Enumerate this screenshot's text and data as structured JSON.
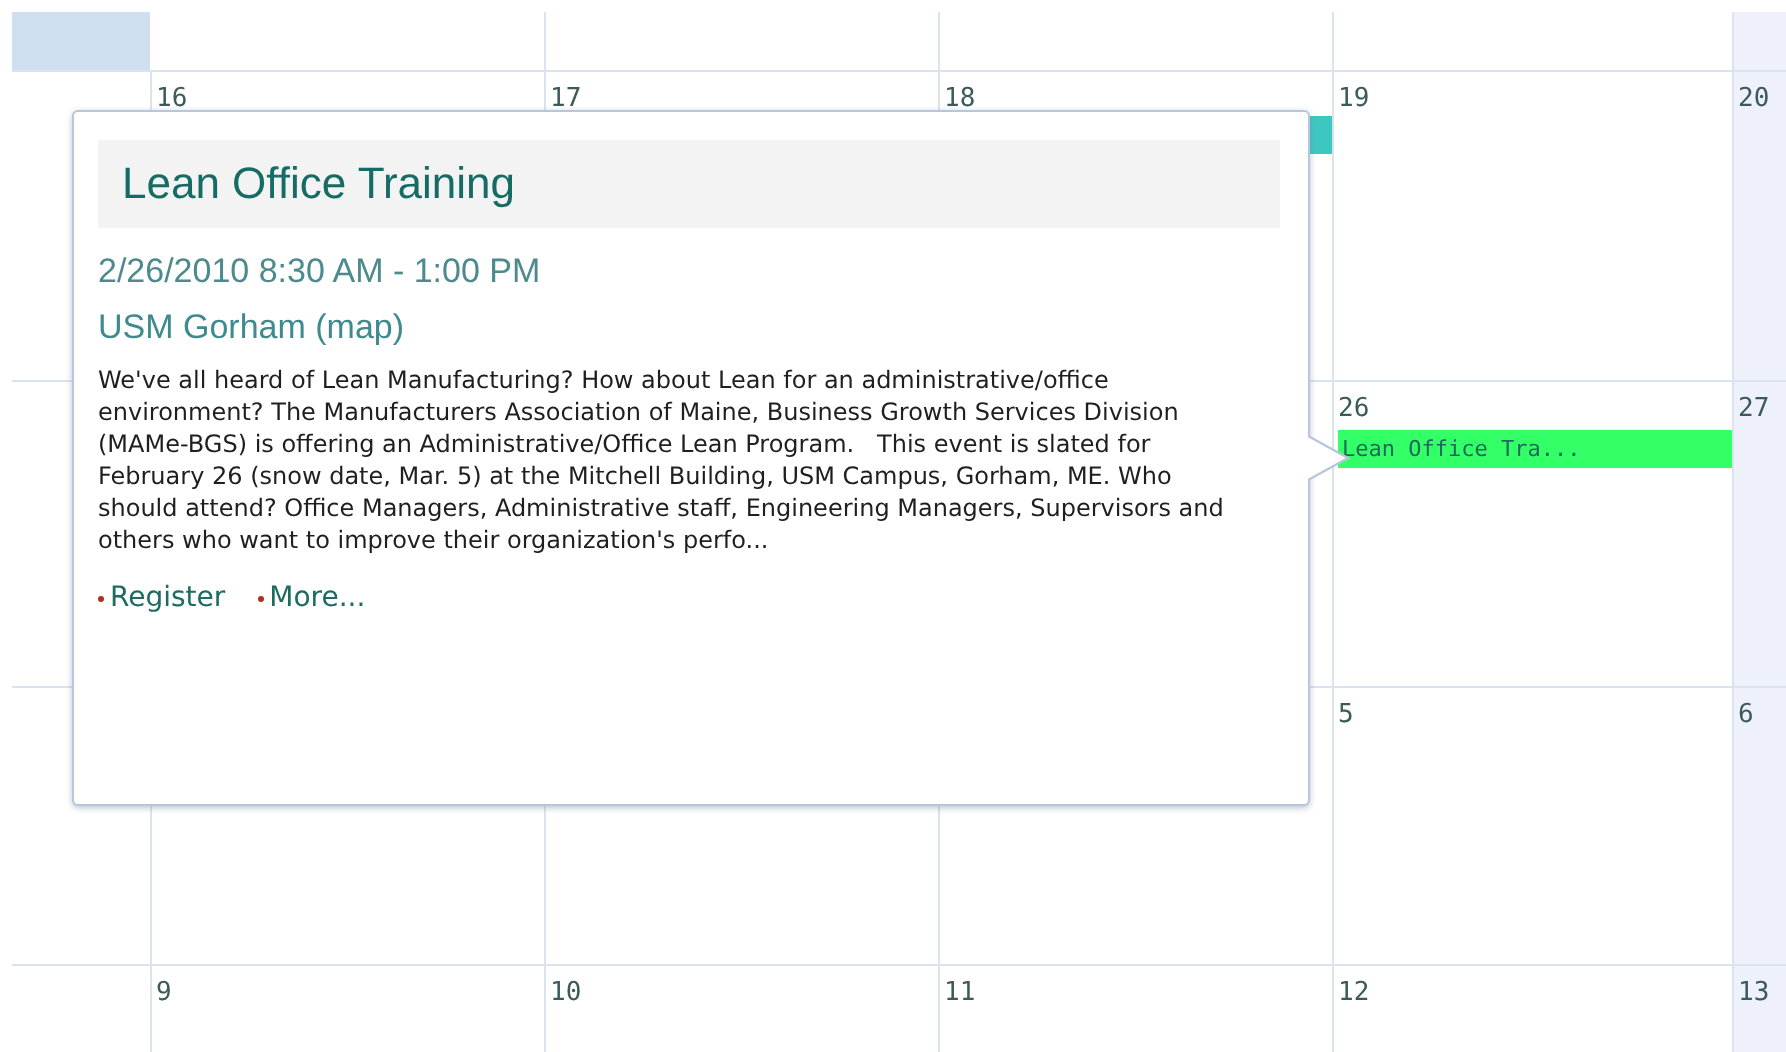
{
  "weeks": [
    {
      "days": [
        {
          "number": "16"
        },
        {
          "number": "17"
        },
        {
          "number": "18",
          "events": [
            {
              "color": "#3cc8c0"
            }
          ]
        },
        {
          "number": "19"
        },
        {
          "number": "20",
          "weekend": true
        }
      ]
    },
    {
      "days": [
        {
          "number": "26",
          "events": [
            {
              "title": "Lean Office Tra...",
              "color": "#33ff66"
            }
          ]
        },
        {
          "number": "27",
          "weekend": true
        }
      ]
    },
    {
      "days": [
        {
          "number": "5"
        },
        {
          "number": "6",
          "weekend": true
        }
      ]
    },
    {
      "days": [
        {
          "number": "9"
        },
        {
          "number": "10"
        },
        {
          "number": "11"
        },
        {
          "number": "12"
        },
        {
          "number": "13",
          "weekend": true
        }
      ]
    }
  ],
  "popup": {
    "title": "Lean Office Training",
    "datetime": "2/26/2010 8:30 AM - 1:00 PM",
    "location": "USM Gorham (map)",
    "description": "We've all heard of Lean Manufacturing? How about Lean for an administrative/office environment? The Manufacturers Association of Maine, Business Growth Services Division (MAMe-BGS) is offering an Administrative/Office Lean Program.   This event is slated for February 26 (snow date, Mar. 5) at the Mitchell Building, USM Campus, Gorham, ME. Who should attend? Office Managers, Administrative staff, Engineering Managers, Supervisors and others who want to improve their organization's perfo...",
    "links": [
      "Register",
      "More..."
    ]
  }
}
